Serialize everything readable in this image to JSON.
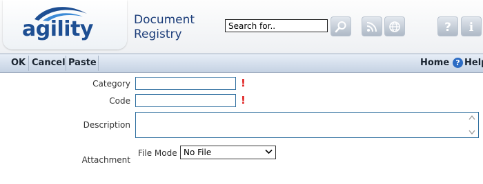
{
  "header": {
    "logo_text": "agility",
    "title_line1": "Document",
    "title_line2": "Registry",
    "search": {
      "value": "Search for.."
    },
    "icons": [
      "search-icon",
      "rss-icon",
      "globe-icon",
      "question-icon",
      "info-icon"
    ]
  },
  "toolbar": {
    "ok_label": "OK",
    "cancel_label": "Cancel",
    "paste_label": "Paste",
    "home_label": "Home",
    "help_label": "Help"
  },
  "form": {
    "category_label": "Category",
    "category_value": "",
    "code_label": "Code",
    "code_value": "",
    "required_mark": "!",
    "description_label": "Description",
    "description_value": "",
    "attachment_label": "Attachment",
    "file_mode_label": "File Mode",
    "file_mode_selected": "No File"
  },
  "colors": {
    "brand_blue": "#1e4f93",
    "field_border": "#2f6f9f",
    "required_red": "#e02020",
    "toolbar_bg": "#c5d2e3"
  }
}
